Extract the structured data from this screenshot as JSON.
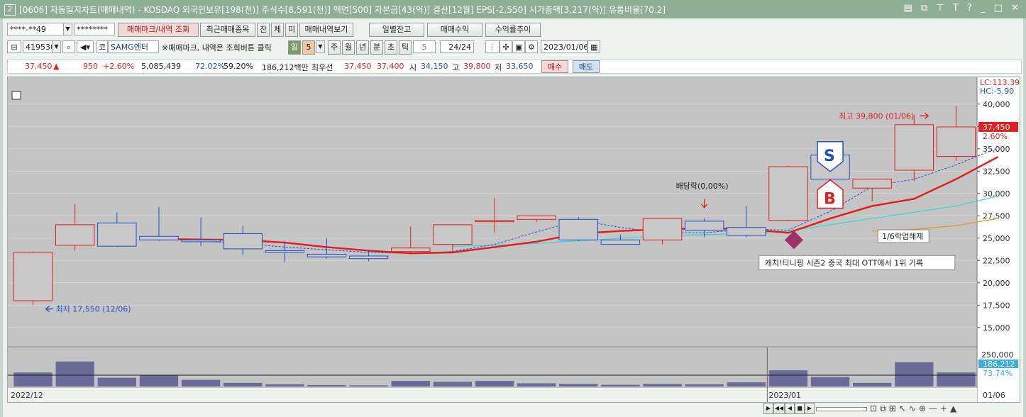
{
  "title": {
    "window_number": "2",
    "text": "[0606] 자동일지차트(매매내역) - KOSDAQ 외국인보유[198(천)] 주식수[8,591(천)] 액면[500] 자본금[43(억)] 결산[12월] EPS[-2,550] 시가총액[3,217(억)] 유통비율[70.2]",
    "icons": [
      "window-restore-icon",
      "window-copy-icon",
      "pin-icon",
      "text-icon",
      "help-icon",
      "minimize-icon",
      "maximize-icon",
      "close-icon"
    ],
    "icon_glyphs": [
      "▤",
      "⧉",
      "⊤",
      "T",
      "?",
      "_",
      "□",
      "✕"
    ]
  },
  "toolbar1": {
    "account": "****-**49",
    "password": "********",
    "tabs": [
      "매매마크/내역 조회",
      "최근매매종목",
      "잔",
      "체",
      "미",
      "매매내역보기"
    ],
    "right_buttons": [
      "일별잔고",
      "매매수익",
      "수익률추이"
    ]
  },
  "toolbar2": {
    "code": "419530",
    "market_label": "코",
    "stock_name": "SAMG엔터",
    "hint": "※매매마크, 내역은 조회버튼 클릭",
    "period_buttons": [
      "일",
      "5",
      "주",
      "월",
      "년",
      "분",
      "초",
      "틱"
    ],
    "tick_value": "5",
    "page": "24/24",
    "date": "2023/01/06"
  },
  "quote": {
    "price": "37,450",
    "change_arrow": "▲",
    "change": "950",
    "change_rate": "+2.60%",
    "volume": "5,085,439",
    "vol_ratio": "72.02%",
    "turnover": "59.20%",
    "amount": "186,212백만",
    "priority_label": "최우선",
    "ask": "37,450",
    "bid": "37,400",
    "open_label": "시",
    "open": "34,150",
    "high_label": "고",
    "high": "39,800",
    "low_label": "저",
    "low": "33,650",
    "buy_label": "매수",
    "sell_label": "매도"
  },
  "chart_data": {
    "type": "candlestick",
    "lc_label": "LC:113.39",
    "hc_label": "HC:-5.90",
    "price_ticks": [
      40000,
      37500,
      35000,
      32500,
      30000,
      27500,
      25000,
      22500,
      20000,
      17500,
      15000
    ],
    "price_tick_labels": [
      "40,000",
      "37,500",
      "35,000",
      "32,500",
      "30,000",
      "27,500",
      "25,000",
      "22,500",
      "20,000",
      "17,500",
      "15,000"
    ],
    "ylim": [
      13000,
      43000
    ],
    "current_price_label": "37,450",
    "current_rate_label": "2.60%",
    "candles": [
      {
        "o": 18000,
        "h": 23500,
        "l": 17550,
        "c": 23400
      },
      {
        "o": 24200,
        "h": 28800,
        "l": 23600,
        "c": 26500
      },
      {
        "o": 26700,
        "h": 27900,
        "l": 24000,
        "c": 24100
      },
      {
        "o": 25200,
        "h": 28500,
        "l": 24700,
        "c": 24800
      },
      {
        "o": 24800,
        "h": 27300,
        "l": 24100,
        "c": 24600
      },
      {
        "o": 25500,
        "h": 26400,
        "l": 23100,
        "c": 23800
      },
      {
        "o": 23600,
        "h": 24700,
        "l": 22300,
        "c": 23400
      },
      {
        "o": 23200,
        "h": 25000,
        "l": 22700,
        "c": 22900
      },
      {
        "o": 23000,
        "h": 23700,
        "l": 22400,
        "c": 22700
      },
      {
        "o": 23500,
        "h": 26300,
        "l": 23200,
        "c": 23900
      },
      {
        "o": 24300,
        "h": 26500,
        "l": 23400,
        "c": 26500
      },
      {
        "o": 27000,
        "h": 29500,
        "l": 25600,
        "c": 27000
      },
      {
        "o": 27100,
        "h": 27300,
        "l": 26800,
        "c": 27500
      },
      {
        "o": 27100,
        "h": 27400,
        "l": 24700,
        "c": 24800
      },
      {
        "o": 24800,
        "h": 25400,
        "l": 24300,
        "c": 24300
      },
      {
        "o": 24800,
        "h": 27200,
        "l": 24300,
        "c": 27200
      },
      {
        "o": 26900,
        "h": 27200,
        "l": 25100,
        "c": 25900
      },
      {
        "o": 26200,
        "h": 28600,
        "l": 25100,
        "c": 25300
      },
      {
        "o": 27000,
        "h": 33100,
        "l": 26900,
        "c": 33000
      },
      {
        "o": 34300,
        "h": 34800,
        "l": 31600,
        "c": 31600
      },
      {
        "o": 30600,
        "h": 31600,
        "l": 29100,
        "c": 31600
      },
      {
        "o": 32600,
        "h": 38800,
        "l": 31400,
        "c": 37700
      },
      {
        "o": 34150,
        "h": 39800,
        "l": 33650,
        "c": 37450
      }
    ],
    "ma_red": [
      null,
      null,
      null,
      24900,
      24850,
      24800,
      24500,
      24000,
      23600,
      23300,
      23400,
      24000,
      24600,
      25500,
      25800,
      26000,
      26100,
      26000,
      25600,
      27200,
      28600,
      29400,
      31600,
      34100
    ],
    "ma_blue": [
      null,
      null,
      null,
      null,
      24700,
      24400,
      24000,
      23700,
      23400,
      23300,
      23500,
      24300,
      25700,
      27000,
      26200,
      25600,
      25600,
      26000,
      25900,
      28000,
      30800,
      31600,
      33200,
      35100
    ],
    "ma_cyan": [
      null,
      null,
      null,
      null,
      null,
      null,
      null,
      null,
      null,
      null,
      24100,
      24200,
      24400,
      24700,
      25000,
      25200,
      25400,
      25500,
      25800,
      26500,
      27200,
      27900,
      28600,
      29700
    ],
    "ma_orange": [
      null,
      null,
      null,
      null,
      null,
      null,
      null,
      null,
      null,
      null,
      null,
      null,
      null,
      null,
      null,
      null,
      null,
      null,
      null,
      null,
      25800,
      26000,
      26400,
      27200
    ],
    "annotations": {
      "high": "최고 39,800 (01/06)",
      "low": "최저 17,550 (12/06)",
      "dividend": "배당락(0,00%)",
      "news": "캐치!티니핑 시즌2 중국 최대 OTT에서 1위 기록",
      "halt": "1/6락업해제",
      "sell_mark": "S",
      "buy_mark": "B"
    },
    "volume": [
      95000,
      170000,
      60000,
      75000,
      45000,
      25000,
      15000,
      10000,
      8000,
      38000,
      32000,
      38000,
      22000,
      18000,
      12000,
      18000,
      15000,
      28000,
      110000,
      65000,
      25000,
      165000,
      95000
    ],
    "volume_ticks": [
      "250,000"
    ],
    "volume_current": "186,212",
    "volume_rate": "73.74%",
    "x_labels": [
      "2022/12",
      "2023/01",
      "01/06"
    ]
  },
  "bottombar": {
    "nav_buttons": [
      "▶",
      "◀◀",
      "◀",
      "■",
      "▶"
    ],
    "icons": [
      "fit-icon",
      "copy-icon",
      "grid-icon",
      "cursor-icon",
      "line-icon",
      "zoom-icon",
      "minus-icon",
      "plus-icon"
    ],
    "glyphs": [
      "⊡",
      "⧉",
      "⊞",
      "↖",
      "∿",
      "⊕",
      "—",
      "+",
      "▲"
    ]
  },
  "colors": {
    "up": "#e02020",
    "down": "#2050c8",
    "candle_fill_up": "#c8c8c8",
    "ma_red": "#e21b1b",
    "ma_blue": "#3344cc",
    "ma_cyan": "#37d5d5",
    "ma_orange": "#f09020",
    "volume": "#6b6b9a"
  }
}
